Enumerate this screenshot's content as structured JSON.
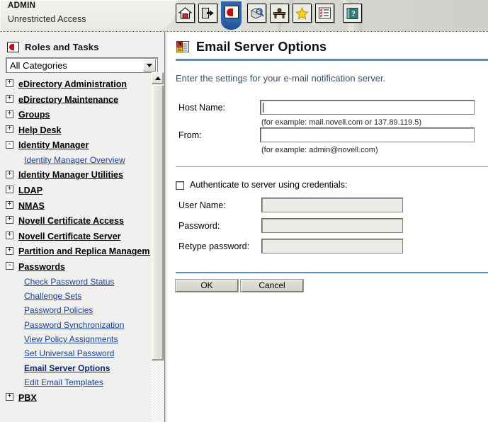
{
  "header": {
    "user": "ADMIN",
    "access": "Unrestricted Access",
    "toolbar": [
      {
        "name": "home-icon",
        "label": "Home"
      },
      {
        "name": "exit-icon",
        "label": "Exit"
      },
      {
        "name": "roles-and-tasks-icon",
        "label": "Roles and Tasks"
      },
      {
        "name": "view-objects-icon",
        "label": "View Objects"
      },
      {
        "name": "configure-icon",
        "label": "Configure"
      },
      {
        "name": "favorites-icon",
        "label": "Favorites"
      },
      {
        "name": "task-list-icon",
        "label": "Task List"
      },
      {
        "name": "help-icon",
        "label": "Help"
      }
    ]
  },
  "sidebar": {
    "panel_title": "Roles and Tasks",
    "category_select": {
      "value": "All Categories",
      "options": [
        "All Categories"
      ]
    },
    "tree": [
      {
        "label": "eDirectory Administration",
        "expander": "+",
        "expanded": false,
        "children": []
      },
      {
        "label": "eDirectory Maintenance",
        "expander": "+",
        "expanded": false,
        "children": []
      },
      {
        "label": "Groups",
        "expander": "+",
        "expanded": false,
        "children": []
      },
      {
        "label": "Help Desk",
        "expander": "+",
        "expanded": false,
        "children": []
      },
      {
        "label": "Identity Manager",
        "expander": "-",
        "expanded": true,
        "children": [
          {
            "label": "Identity Manager Overview",
            "current": false
          }
        ]
      },
      {
        "label": "Identity Manager Utilities",
        "expander": "+",
        "expanded": false,
        "children": []
      },
      {
        "label": "LDAP",
        "expander": "+",
        "expanded": false,
        "children": []
      },
      {
        "label": "NMAS",
        "expander": "+",
        "expanded": false,
        "children": []
      },
      {
        "label": "Novell Certificate Access",
        "expander": "+",
        "expanded": false,
        "children": []
      },
      {
        "label": "Novell Certificate Server",
        "expander": "+",
        "expanded": false,
        "children": []
      },
      {
        "label": "Partition and Replica Management",
        "expander": "+",
        "expanded": false,
        "children": []
      },
      {
        "label": "Passwords",
        "expander": "-",
        "expanded": true,
        "children": [
          {
            "label": "Check Password Status",
            "current": false
          },
          {
            "label": "Challenge Sets",
            "current": false
          },
          {
            "label": "Password Policies",
            "current": false
          },
          {
            "label": "Password Synchronization",
            "current": false
          },
          {
            "label": "View Policy Assignments",
            "current": false
          },
          {
            "label": "Set Universal Password",
            "current": false
          },
          {
            "label": "Email Server Options",
            "current": true
          },
          {
            "label": "Edit Email Templates",
            "current": false
          }
        ]
      },
      {
        "label": "PBX",
        "expander": "+",
        "expanded": false,
        "children": []
      }
    ]
  },
  "page": {
    "title": "Email Server Options",
    "title_icon": "email-server-options-icon",
    "intro": "Enter the settings for your e-mail notification server.",
    "fields": {
      "host_name": {
        "label": "Host Name:",
        "value": "",
        "hint": "(for example: mail.novell.com or 137.89.119.5)"
      },
      "from": {
        "label": "From:",
        "value": "",
        "hint": "(for example: admin@novell.com)"
      }
    },
    "authenticate": {
      "checkbox_label": "Authenticate to server using credentials:",
      "checked": false,
      "user_name": {
        "label": "User Name:",
        "value": "",
        "disabled": true
      },
      "password": {
        "label": "Password:",
        "value": "",
        "disabled": true
      },
      "retype_password": {
        "label": "Retype password:",
        "value": "",
        "disabled": true
      }
    },
    "buttons": {
      "ok": "OK",
      "cancel": "Cancel"
    }
  },
  "colors": {
    "accent_blue": "#5590c4",
    "link_blue": "#1b3f9e",
    "header_bg": "#e2e2dd",
    "panel_bg": "#f0f0ee"
  }
}
